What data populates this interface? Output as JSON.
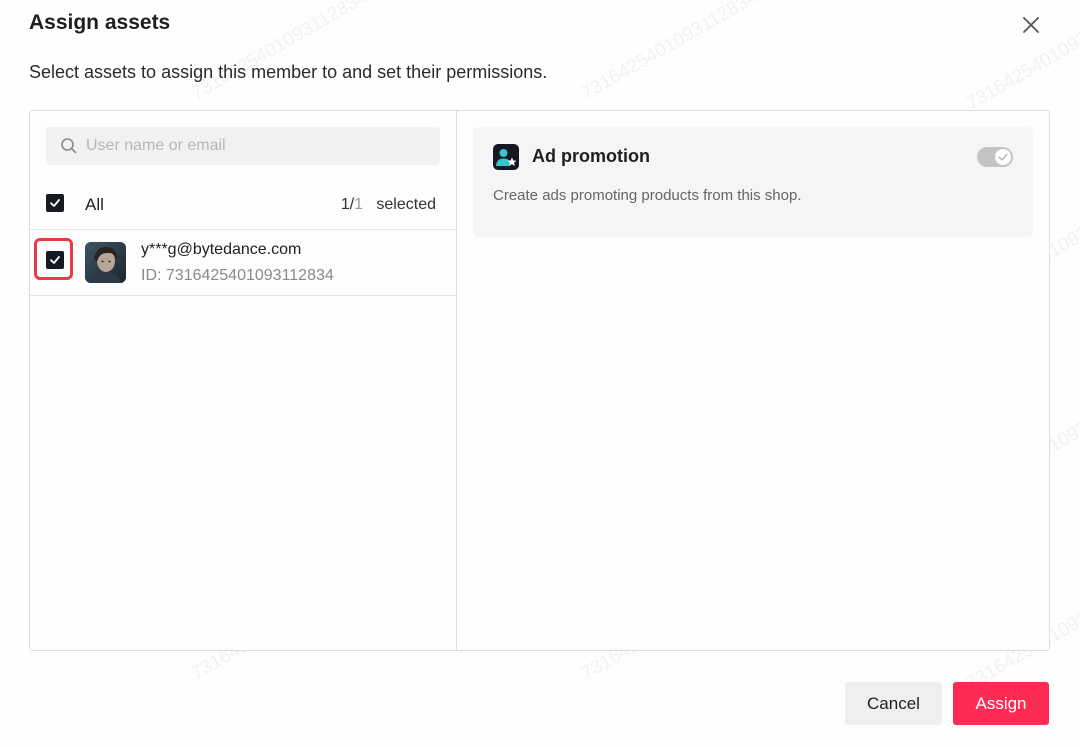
{
  "dialog": {
    "title": "Assign assets",
    "subtitle": "Select assets to assign this member to and set their permissions.",
    "close_icon": "close-icon"
  },
  "left": {
    "search": {
      "value": "",
      "placeholder": "User name or email",
      "icon": "search-icon"
    },
    "all_checkbox_checked": true,
    "all_label": "All",
    "selected_num": "1/",
    "selected_den": "1",
    "selected_label": "selected",
    "members": [
      {
        "checked": true,
        "email": "y***g@bytedance.com",
        "id_text": "ID: 7316425401093112834"
      }
    ]
  },
  "right": {
    "card": {
      "icon": "user-star-icon",
      "title": "Ad promotion",
      "description": "Create ads promoting products from this shop.",
      "toggle_on": true
    }
  },
  "footer": {
    "cancel_label": "Cancel",
    "assign_label": "Assign"
  },
  "watermark": "7316425401093112834",
  "colors": {
    "accent": "#fe2c55",
    "highlight": "#e63c47",
    "checkbox": "#161823"
  }
}
